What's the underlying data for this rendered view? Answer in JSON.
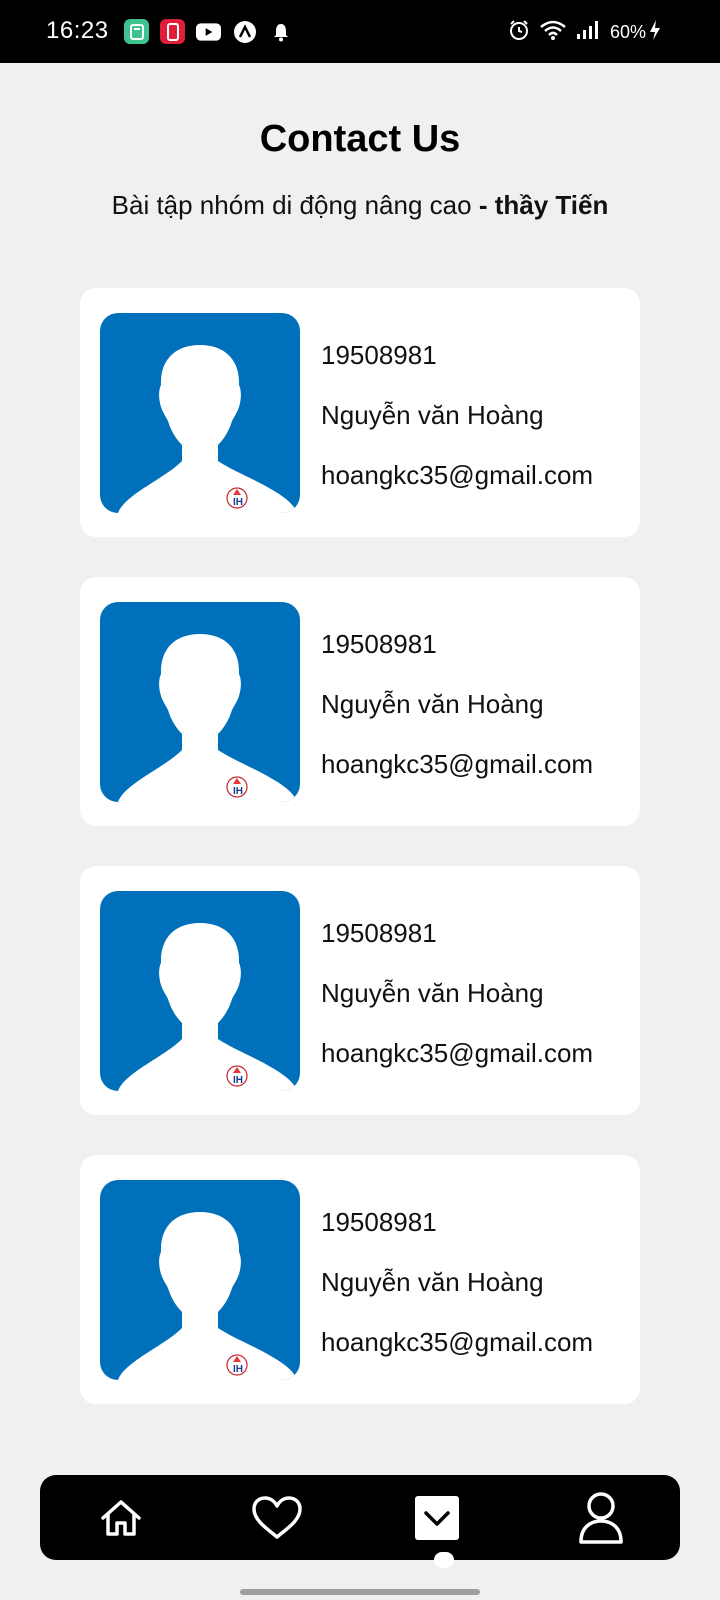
{
  "status_bar": {
    "time": "16:23",
    "battery": "60%",
    "left_icons": [
      "calculator-app-icon",
      "phone-app-icon",
      "youtube-icon",
      "app-icon",
      "bell-icon"
    ],
    "right_icons": [
      "alarm-icon",
      "wifi-icon",
      "signal-icon",
      "battery-charging-icon"
    ]
  },
  "header": {
    "title": "Contact Us",
    "subtitle_prefix": "Bài tập nhóm di động nâng cao",
    "subtitle_bold": "- thầy Tiến"
  },
  "contacts": [
    {
      "id": "19508981",
      "name": "Nguyễn văn Hoàng",
      "email": "hoangkc35@gmail.com"
    },
    {
      "id": "19508981",
      "name": "Nguyễn văn Hoàng",
      "email": "hoangkc35@gmail.com"
    },
    {
      "id": "19508981",
      "name": "Nguyễn văn Hoàng",
      "email": "hoangkc35@gmail.com"
    },
    {
      "id": "19508981",
      "name": "Nguyễn văn Hoàng",
      "email": "hoangkc35@gmail.com"
    }
  ],
  "bottom_nav": {
    "items": [
      "home-icon",
      "heart-icon",
      "chevron-down-icon",
      "user-icon"
    ],
    "active": "chevron-down-icon"
  },
  "colors": {
    "background": "#f0f0f0",
    "avatar_bg": "#0070bb",
    "nav_bg": "#000000",
    "card_bg": "#ffffff"
  }
}
